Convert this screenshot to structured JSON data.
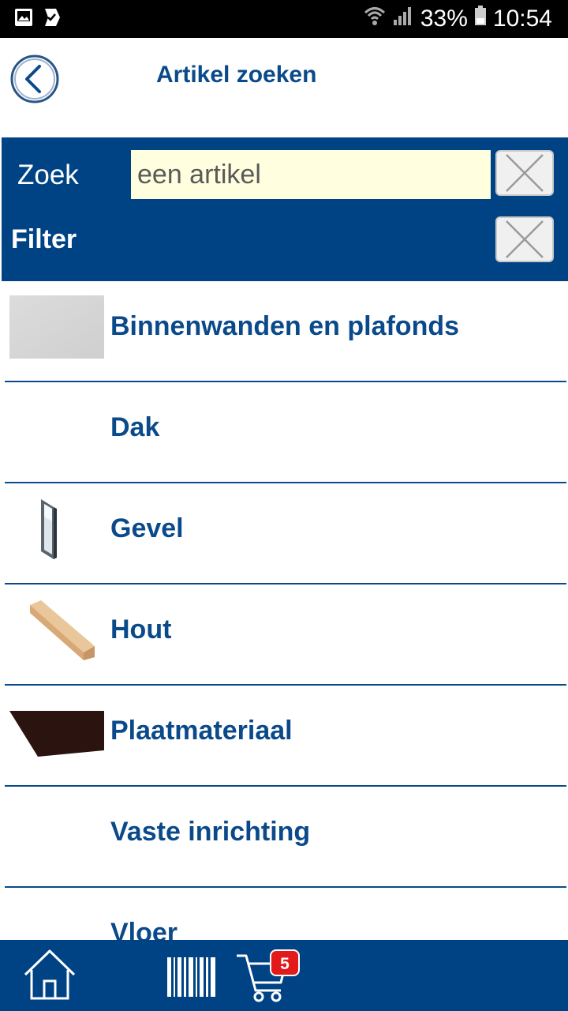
{
  "status_bar": {
    "battery": "33%",
    "time": "10:54",
    "icons": [
      "image-icon",
      "checklist-icon",
      "wifi-icon",
      "signal-icon",
      "battery-icon"
    ]
  },
  "header": {
    "title": "Artikel zoeken",
    "back_icon": "back-arrow-icon"
  },
  "search": {
    "label": "Zoek",
    "placeholder": "een artikel",
    "value": "",
    "filter_label": "Filter",
    "clear_icon": "close-icon"
  },
  "categories": [
    {
      "label": "Binnenwanden en plafonds",
      "thumb": "gypsum-board"
    },
    {
      "label": "Dak",
      "thumb": ""
    },
    {
      "label": "Gevel",
      "thumb": "window-frame"
    },
    {
      "label": "Hout",
      "thumb": "wood-beam"
    },
    {
      "label": "Plaatmateriaal",
      "thumb": "dark-panel"
    },
    {
      "label": "Vaste inrichting",
      "thumb": ""
    },
    {
      "label": "Vloer",
      "thumb": ""
    }
  ],
  "bottom_nav": {
    "cart_count": "5",
    "icons": [
      "home-icon",
      "barcode-icon",
      "cart-icon"
    ]
  },
  "colors": {
    "brand_blue": "#004385",
    "text_blue": "#0b4a8a",
    "input_bg": "#ffffe0",
    "badge_red": "#e21a1a"
  }
}
